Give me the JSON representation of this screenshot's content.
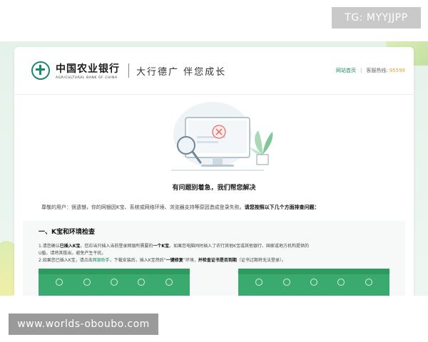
{
  "watermark_top": "TG: MYYJJPP",
  "watermark_bottom": "www.worlds-oboubo.com",
  "header": {
    "bank_name_cn": "中国农业银行",
    "bank_name_en": "AGRICULTURAL BANK OF CHINA",
    "slogan": "大行德广 伴您成长",
    "home_link": "网站首页",
    "hotline_label": "客服热线:",
    "hotline_number": "95599"
  },
  "main": {
    "headline": "有问题别着急，我们帮您解决",
    "intro_prefix": "尊敬的用户：很遗憾，你的网银因K宝、系统或网络环境、浏览器支持等原因造成登录失败。",
    "intro_bold": "请您按照以下几个方面排查问题：",
    "section": {
      "title": "一、K宝和环境检查",
      "step1_a": "1.请您确认",
      "step1_b": "已插入K宝",
      "step1_c": "。您应当只插入当前登录网银所需要的",
      "step1_d": "一个K宝",
      "step1_e": "。如果您电脑同时插入了农行其他K宝或其他银行、国家或地方机构提供的",
      "step1_f": "U盾，请将其拔出，避免产生干扰。",
      "step2_a": "2.如果您已插入K宝，请点击",
      "step2_link": "网银助手",
      "step2_b": "，下载安装后，插入K宝然后“",
      "step2_c": "一键修复",
      "step2_d": "”环境，",
      "step2_e": "并检查证书是否到期",
      "step2_f": "（证书过期将无法登录）。"
    }
  },
  "colors": {
    "brand_green": "#1a8a6b",
    "hotline_orange": "#e2a33a",
    "screen_green": "#3aaa6e",
    "error_red": "#e06a5f"
  },
  "icons": [
    "abc-logo-icon",
    "magnifier-icon",
    "error-x-icon",
    "plant-icon"
  ]
}
